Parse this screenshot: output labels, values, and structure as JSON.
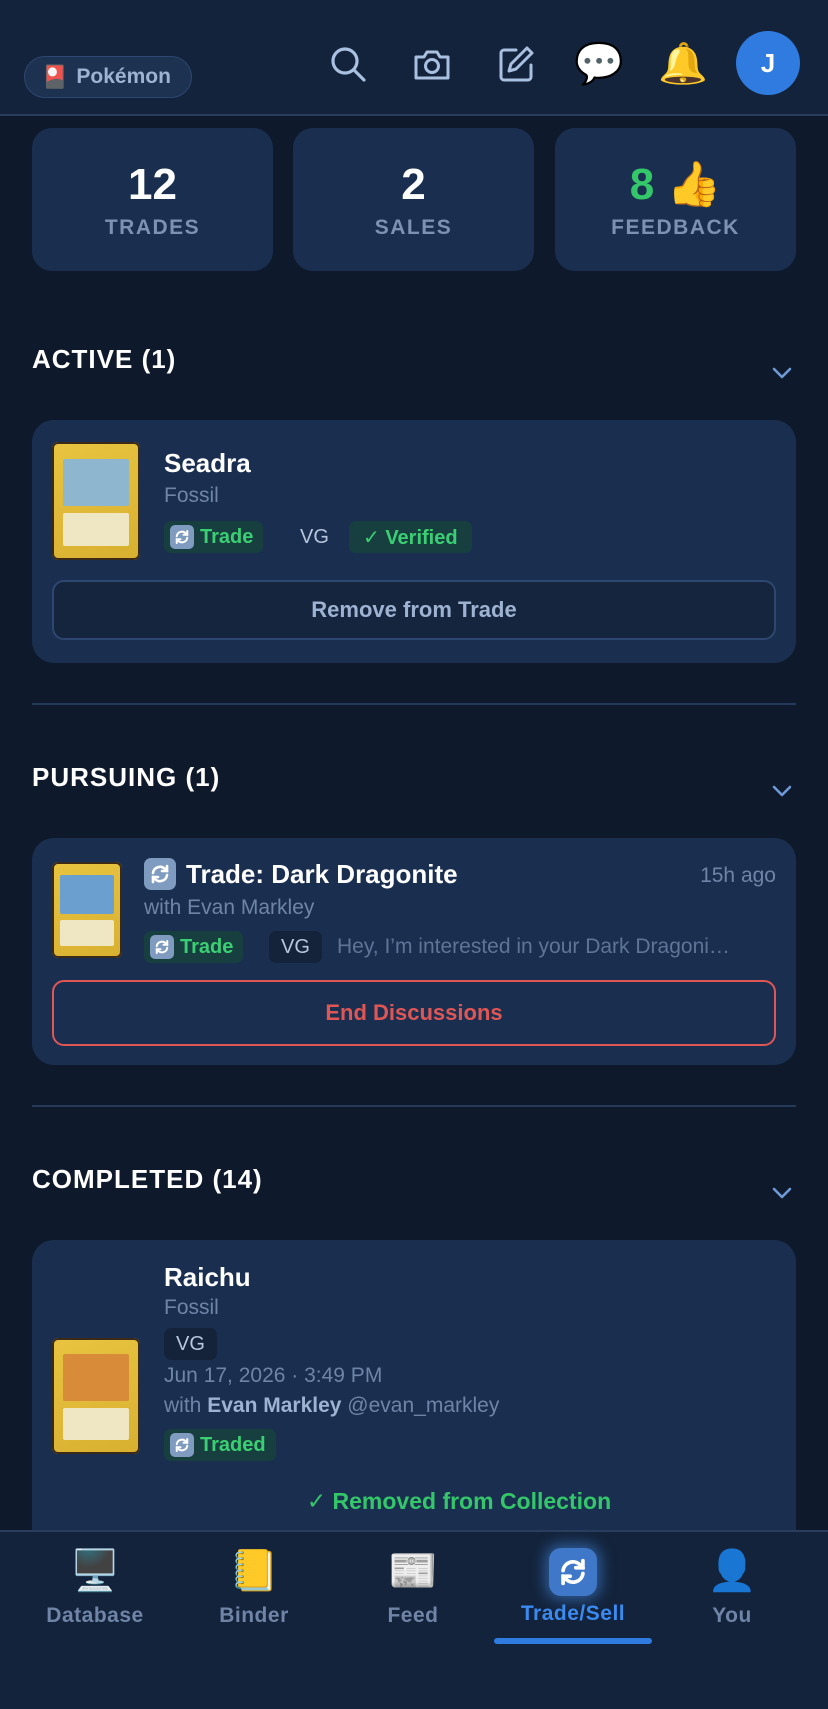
{
  "header": {
    "game_pill": {
      "emoji": "🎴",
      "label": "Pokémon"
    },
    "icons": [
      "search-icon",
      "camera-icon",
      "edit-icon",
      "chat-icon",
      "bell-icon"
    ],
    "chat_emoji": "💬",
    "bell_emoji": "🔔",
    "avatar_initial": "J"
  },
  "stats": [
    {
      "value": "12",
      "label": "TRADES"
    },
    {
      "value": "2",
      "label": "SALES"
    },
    {
      "value": "8 👍",
      "label": "FEEDBACK"
    }
  ],
  "sections": {
    "active": {
      "title": "ACTIVE (1)",
      "card": {
        "name": "Seadra",
        "set": "Fossil",
        "trade_badge": "Trade",
        "condition": "VG",
        "verified_badge": "✓ Verified",
        "button": "Remove from Trade"
      }
    },
    "pursuing": {
      "title": "PURSUING (1)",
      "card": {
        "title": "Trade: Dark Dragonite",
        "time": "15h ago",
        "with": "with Evan Markley",
        "trade_badge": "Trade",
        "condition": "VG",
        "message": "Hey, I’m interested in your Dark Dragoni…",
        "button": "End Discussions"
      }
    },
    "completed": {
      "title": "COMPLETED (14)",
      "card": {
        "name": "Raichu",
        "set": "Fossil",
        "condition": "VG",
        "date": "Jun 17, 2026 · 3:49 PM",
        "with_prefix": "with",
        "with_name": "Evan Markley",
        "with_handle": "@evan_markley",
        "traded_badge": "Traded",
        "removed": "✓ Removed from Collection"
      }
    }
  },
  "bottom_nav": [
    {
      "emoji": "🖥️",
      "label": "Database"
    },
    {
      "emoji": "📒",
      "label": "Binder"
    },
    {
      "emoji": "📰",
      "label": "Feed"
    },
    {
      "emoji": "",
      "label": "Trade/Sell"
    },
    {
      "emoji": "👤",
      "label": "You"
    }
  ],
  "colors": {
    "background": "#0e1a2b",
    "card": "#1a2f50",
    "accent_blue": "#2f7be0",
    "green": "#34c76a",
    "danger": "#e05654"
  }
}
